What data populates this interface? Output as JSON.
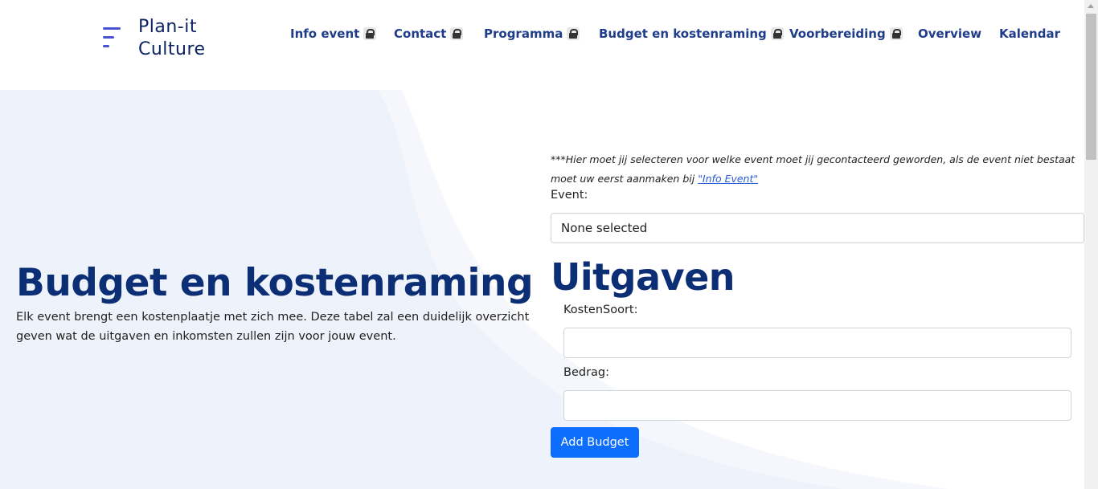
{
  "brand": {
    "line1": "Plan-it",
    "line2": "Culture",
    "icon": "menu-lines-icon"
  },
  "nav": {
    "items": [
      {
        "label": "Info event",
        "locked": true
      },
      {
        "label": "Contact",
        "locked": true
      },
      {
        "label": "Programma",
        "locked": true
      },
      {
        "label": "Budget en kostenraming",
        "locked": true
      },
      {
        "label": "Voorbereiding",
        "locked": true
      },
      {
        "label": "Overview",
        "locked": false
      },
      {
        "label": "Kalendar",
        "locked": false
      }
    ],
    "lock_icon": "lock-icon"
  },
  "hero": {
    "title": "Budget en kostenraming",
    "description": "Elk event brengt een kostenplaatje met zich mee. Deze tabel zal een duidelijk overzicht geven wat de uitgaven en inkomsten zullen zijn voor jouw event."
  },
  "form": {
    "note_text": "***Hier moet jij selecteren voor welke event moet jij gecontacteerd geworden, als de event niet bestaat moet uw eerst aanmaken bij ",
    "note_link": "\"Info Event\"",
    "event_label": "Event:",
    "event_value": "None selected",
    "section_title": "Uitgaven",
    "kostensoort_label": "KostenSoort:",
    "kostensoort_value": "",
    "bedrag_label": "Bedrag:",
    "bedrag_value": "",
    "submit_label": "Add Budget"
  },
  "colors": {
    "primary": "#0d6efd",
    "heading": "#0c2e75",
    "nav": "#1f3d8a",
    "brand_icon": "#4a52d4",
    "hero_bg": "#eef2fb"
  }
}
